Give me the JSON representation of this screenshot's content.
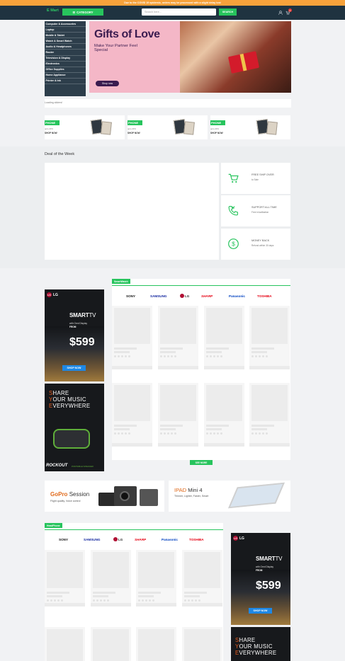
{
  "topbar": {
    "notice": "Due to the COVID 19 epidemic, orders may be processed with a slight delay lost"
  },
  "header": {
    "logo": "E Mart",
    "category_btn": "CATEGORY",
    "search_placeholder": "Search here...",
    "search_btn": "SEARCH",
    "cart_count": "0"
  },
  "menu": {
    "items": [
      "Computer & Accessories",
      "Laptop",
      "Mobile & Tablet",
      "Watch & Smart Watch",
      "Audio & Headphones",
      "Router",
      "Television & Display",
      "Electronics",
      "Office Supplies",
      "Home Appliance",
      "Printer & Ink"
    ]
  },
  "hero": {
    "title": "Gifts of Love",
    "subtitle": "Make Your Partner Feel Special",
    "button": "Shop now"
  },
  "strip": {
    "text": "Loading sliders!"
  },
  "promos": [
    {
      "tag": "PHONE",
      "line1": "upto 20%",
      "line2": "SHOP NOW"
    },
    {
      "tag": "PHONE",
      "line1": "upto 20%",
      "line2": "SHOP NOW"
    },
    {
      "tag": "PHONE",
      "line1": "upto 20%",
      "line2": "SHOP NOW"
    }
  ],
  "deal": {
    "title": "Deal of the Week"
  },
  "features": [
    {
      "icon": "cart-icon",
      "title": "FREE SHIP OVER",
      "sub": "to Sale"
    },
    {
      "icon": "phone-icon",
      "title": "SUPPORT ALL TIME",
      "sub": "Free in/calibation"
    },
    {
      "icon": "dollar-icon",
      "title": "MONEY BACK",
      "sub": "Refund within 30 days"
    }
  ],
  "ads": {
    "lg_logo": "LG",
    "lg_brand": "LG",
    "smarttv_a": "SMART",
    "smarttv_b": "TV",
    "smarttv_sub1": "with Ored Display",
    "smarttv_sub2": "FROM",
    "smarttv_price": "$599",
    "shop_now": "SHOP NOW",
    "music_l1_o": "S",
    "music_l1": "HARE",
    "music_l2_o": "Y",
    "music_l2": "OUR MUSIC",
    "music_l3_o": "E",
    "music_l3": "VERYWHERE",
    "rockout": "ROCKOUT",
    "rockout_sub": "PORTABLE SPEAKER"
  },
  "smartwatch": {
    "tab": "SmartWatch",
    "brands": [
      "SONY",
      "SAMSUNG",
      "LG",
      "SHARP",
      "Panasonic",
      "TOSHIBA"
    ]
  },
  "headphone": {
    "tab": "HeadPhone",
    "brands": [
      "SONY",
      "SAMSUNG",
      "LG",
      "SHARP",
      "Panasonic",
      "TOSHIBA"
    ]
  },
  "seemore": "SEE MORE",
  "gopro": {
    "title_a": "GoPro",
    "title_b": "Session",
    "sub": "Flight quality, Voice control"
  },
  "ipad": {
    "title_a": "IPAD",
    "title_b": "Mini 4",
    "sub": "Thinner, Lighter, Faster, Smart"
  },
  "colors": {
    "accent": "#27c45d",
    "header": "#1f3340",
    "topbar": "#f7a23b",
    "lg": "#b01033",
    "sony": "#111111",
    "samsung": "#1428a0",
    "sharp": "#e60012",
    "panasonic": "#0041c0",
    "toshiba": "#e60012"
  }
}
